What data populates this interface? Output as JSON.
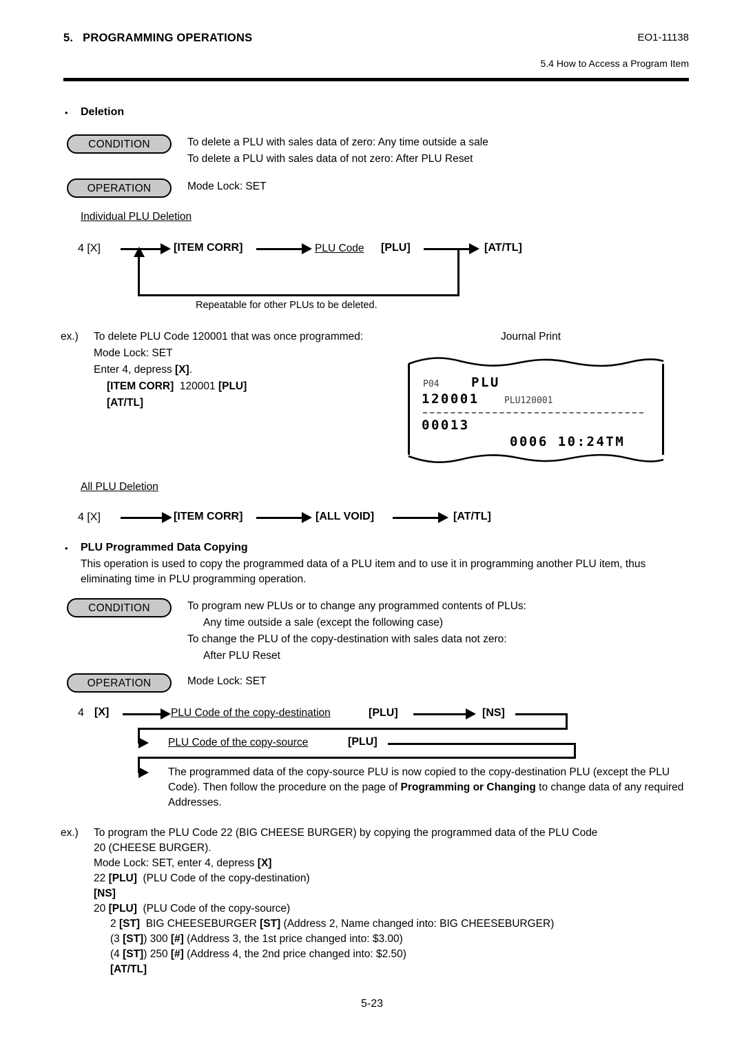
{
  "header": {
    "section_number": "5.",
    "section_title": "PROGRAMMING OPERATIONS",
    "doc_code": "EO1-11138",
    "subsection": "5.4  How to Access a Program Item"
  },
  "deletion": {
    "heading": "Deletion",
    "condition_label": "CONDITION",
    "condition_lines": [
      "To delete a PLU with sales data of zero:  Any time outside a sale",
      "To delete a PLU with sales data of not zero:  After PLU Reset"
    ],
    "operation_label": "OPERATION",
    "operation_text": "Mode Lock:  SET",
    "individual_title": "Individual PLU Deletion",
    "flow": {
      "start": "4 [X]",
      "step2": "[ITEM CORR]",
      "step3_code": "PLU Code",
      "step3_key": "[PLU]",
      "step4": "[AT/TL]",
      "loop_note": "Repeatable for other PLUs to be deleted."
    },
    "example": {
      "prefix": "ex.)",
      "line1": "To delete PLU Code 120001 that was once programmed:",
      "line2": "Mode Lock:  SET",
      "line3_a": "Enter 4, depress ",
      "line3_b": "[X]",
      "line3_c": ".",
      "line4_a": "[ITEM CORR]",
      "line4_b": "120001",
      "line4_c": "[PLU]",
      "line5": "[AT/TL]"
    },
    "journal": {
      "caption": "Journal Print",
      "line1_left": "P04",
      "line1_right": "PLU",
      "line2_left": "120001",
      "line2_right": "PLU120001",
      "line3": "00013",
      "line4": "0006 10:24TM"
    },
    "all_title": "All PLU Deletion",
    "all_flow": {
      "start": "4 [X]",
      "step2": "[ITEM CORR]",
      "step3": "[ALL VOID]",
      "step4": "[AT/TL]"
    }
  },
  "copying": {
    "heading": "PLU Programmed Data Copying",
    "intro": "This operation is used to copy the programmed data of a PLU item and to use it in programming another PLU item, thus eliminating time in PLU programming operation.",
    "condition_label": "CONDITION",
    "condition_lines": [
      "To program new PLUs or to change any programmed contents of PLUs:",
      "Any time outside a sale (except the following case)",
      "To change the PLU of the copy-destination with sales data not zero:",
      "After PLU Reset"
    ],
    "operation_label": "OPERATION",
    "operation_text": "Mode Lock:  SET",
    "flow": {
      "start": "4",
      "start_key": "[X]",
      "dest_code": "PLU Code of the copy-destination",
      "dest_key": "[PLU]",
      "ns_key": "[NS]",
      "src_code": "PLU Code of the copy-source",
      "src_key": "[PLU]",
      "result_a": "The programmed data of the copy-source PLU is now copied to the copy-destination PLU (except the PLU Code). Then follow the procedure on the page of ",
      "result_bold": "Programming or Changing",
      "result_b": " to change data of any required Addresses."
    },
    "example": {
      "prefix": "ex.)",
      "line1": "To program the PLU Code 22 (BIG CHEESE BURGER) by copying the programmed data of the PLU Code",
      "line2": "20 (CHEESE BURGER).",
      "line3_a": "Mode Lock:  SET, enter 4, depress ",
      "line3_b": "[X]",
      "line4_a": "22 ",
      "line4_b": "[PLU]",
      "line4_c": "(PLU Code of the copy-destination)",
      "line5": "[NS]",
      "line6_a": "20 ",
      "line6_b": "[PLU]",
      "line6_c": "(PLU Code of the copy-source)",
      "line7_a": "2 ",
      "line7_b": "[ST]",
      "line7_c": "BIG CHEESEBURGER ",
      "line7_d": "[ST]",
      "line7_e": "(Address 2, Name changed into:  BIG CHEESEBURGER)",
      "line8_a": "(3 ",
      "line8_b": "[ST]",
      "line8_c": ") 300 ",
      "line8_d": "[#]",
      "line8_e": "(Address 3, the 1st price changed into:  $3.00)",
      "line9_a": "(4 ",
      "line9_b": "[ST]",
      "line9_c": ") 250 ",
      "line9_d": "[#]",
      "line9_e": "(Address 4, the 2nd price changed into:  $2.50)",
      "line10": "[AT/TL]"
    }
  },
  "footer": {
    "page": "5-23"
  }
}
